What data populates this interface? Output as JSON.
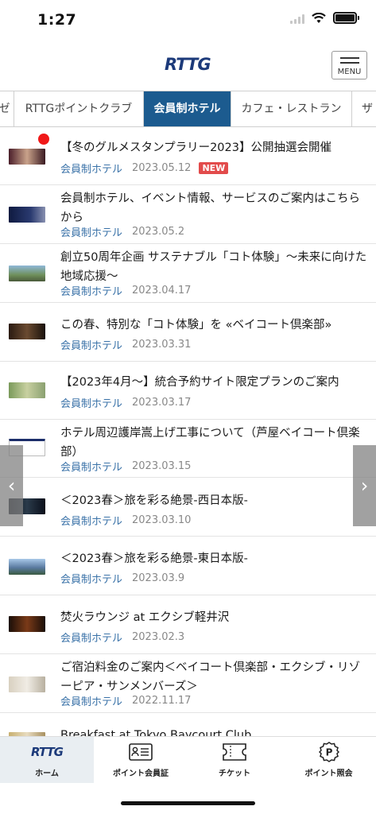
{
  "status": {
    "time": "1:27"
  },
  "header": {
    "logo": "RTTG",
    "menu_label": "MENU"
  },
  "tabs": [
    {
      "label": "ゼ"
    },
    {
      "label": "RTTGポイントクラブ"
    },
    {
      "label": "会員制ホテル",
      "active": true
    },
    {
      "label": "カフェ・レストラン"
    },
    {
      "label": "ザ"
    }
  ],
  "news": [
    {
      "title": "【冬のグルメスタンプラリー2023】公開抽選会開催",
      "category": "会員制ホテル",
      "date": "2023.05.12",
      "badge": "NEW",
      "unread": true
    },
    {
      "title": "会員制ホテル、イベント情報、サービスのご案内はこちらから",
      "category": "会員制ホテル",
      "date": "2023.05.2"
    },
    {
      "title": "創立50周年企画 サステナブル「コト体験」～未来に向けた地域応援～",
      "category": "会員制ホテル",
      "date": "2023.04.17"
    },
    {
      "title": "この春、特別な「コト体験」を «ベイコート倶楽部»",
      "category": "会員制ホテル",
      "date": "2023.03.31"
    },
    {
      "title": "【2023年4月～】統合予約サイト限定プランのご案内",
      "category": "会員制ホテル",
      "date": "2023.03.17"
    },
    {
      "title": "ホテル周辺護岸嵩上げ工事について（芦屋ベイコート倶楽部）",
      "category": "会員制ホテル",
      "date": "2023.03.15"
    },
    {
      "title": "＜2023春＞旅を彩る絶景-西日本版-",
      "category": "会員制ホテル",
      "date": "2023.03.10"
    },
    {
      "title": "＜2023春＞旅を彩る絶景-東日本版-",
      "category": "会員制ホテル",
      "date": "2023.03.9"
    },
    {
      "title": "焚火ラウンジ at エクシブ軽井沢",
      "category": "会員制ホテル",
      "date": "2023.02.3"
    },
    {
      "title": "ご宿泊料金のご案内＜ベイコート倶楽部・エクシブ・リゾーピア・サンメンバーズ＞",
      "category": "会員制ホテル",
      "date": "2022.11.17"
    },
    {
      "title": "Breakfast at Tokyo Baycourt Club",
      "category": "",
      "date": ""
    }
  ],
  "nav": {
    "left_arrow": "‹",
    "right_arrow": "›",
    "items": [
      {
        "label": "ホーム",
        "icon": "rttg-logo-icon",
        "icon_text": "RTTG",
        "active": true
      },
      {
        "label": "ポイント会員証",
        "icon": "member-card-icon"
      },
      {
        "label": "チケット",
        "icon": "ticket-icon"
      },
      {
        "label": "ポイント照会",
        "icon": "point-icon",
        "icon_text": "P"
      }
    ]
  },
  "colors": {
    "brand": "#1c5b8f",
    "category": "#3a72a8",
    "badge": "#e24b4b"
  }
}
